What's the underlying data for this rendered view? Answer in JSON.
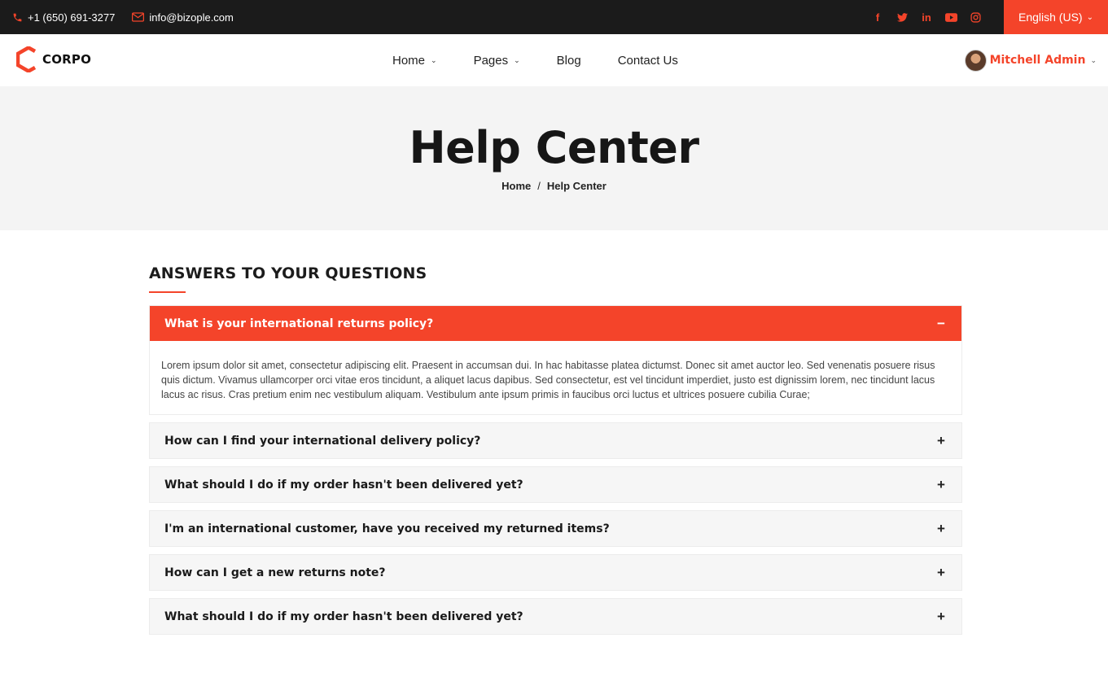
{
  "topbar": {
    "phone": "+1 (650) 691-3277",
    "email": "info@bizople.com",
    "social_icons": [
      "facebook-icon",
      "twitter-icon",
      "linkedin-icon",
      "youtube-icon",
      "instagram-icon"
    ],
    "language": "English (US)"
  },
  "header": {
    "logo_text": "CORPO",
    "nav": [
      {
        "label": "Home",
        "dropdown": true
      },
      {
        "label": "Pages",
        "dropdown": true
      },
      {
        "label": "Blog",
        "dropdown": false
      },
      {
        "label": "Contact Us",
        "dropdown": false
      }
    ],
    "user_name": "Mitchell Admin"
  },
  "hero": {
    "title": "Help Center",
    "breadcrumb": [
      "Home",
      "Help Center"
    ],
    "breadcrumb_sep": "/"
  },
  "section": {
    "title": "ANSWERS TO YOUR QUESTIONS"
  },
  "faq": {
    "expanded_sign": "−",
    "collapsed_sign": "+",
    "items": [
      {
        "question": "What is your international returns policy?",
        "open": true,
        "answer": "Lorem ipsum dolor sit amet, consectetur adipiscing elit. Praesent in accumsan dui. In hac habitasse platea dictumst. Donec sit amet auctor leo. Sed venenatis posuere risus quis dictum. Vivamus ullamcorper orci vitae eros tincidunt, a aliquet lacus dapibus. Sed consectetur, est vel tincidunt imperdiet, justo est dignissim lorem, nec tincidunt lacus lacus ac risus. Cras pretium enim nec vestibulum aliquam. Vestibulum ante ipsum primis in faucibus orci luctus et ultrices posuere cubilia Curae;"
      },
      {
        "question": "How can I find your international delivery policy?",
        "open": false
      },
      {
        "question": "What should I do if my order hasn't been delivered yet?",
        "open": false
      },
      {
        "question": "I'm an international customer, have you received my returned items?",
        "open": false
      },
      {
        "question": "How can I get a new returns note?",
        "open": false
      },
      {
        "question": "What should I do if my order hasn't been delivered yet?",
        "open": false
      }
    ]
  },
  "colors": {
    "accent": "#f4442a",
    "topbar_bg": "#1b1b1b",
    "hero_bg": "#f4f4f4"
  }
}
